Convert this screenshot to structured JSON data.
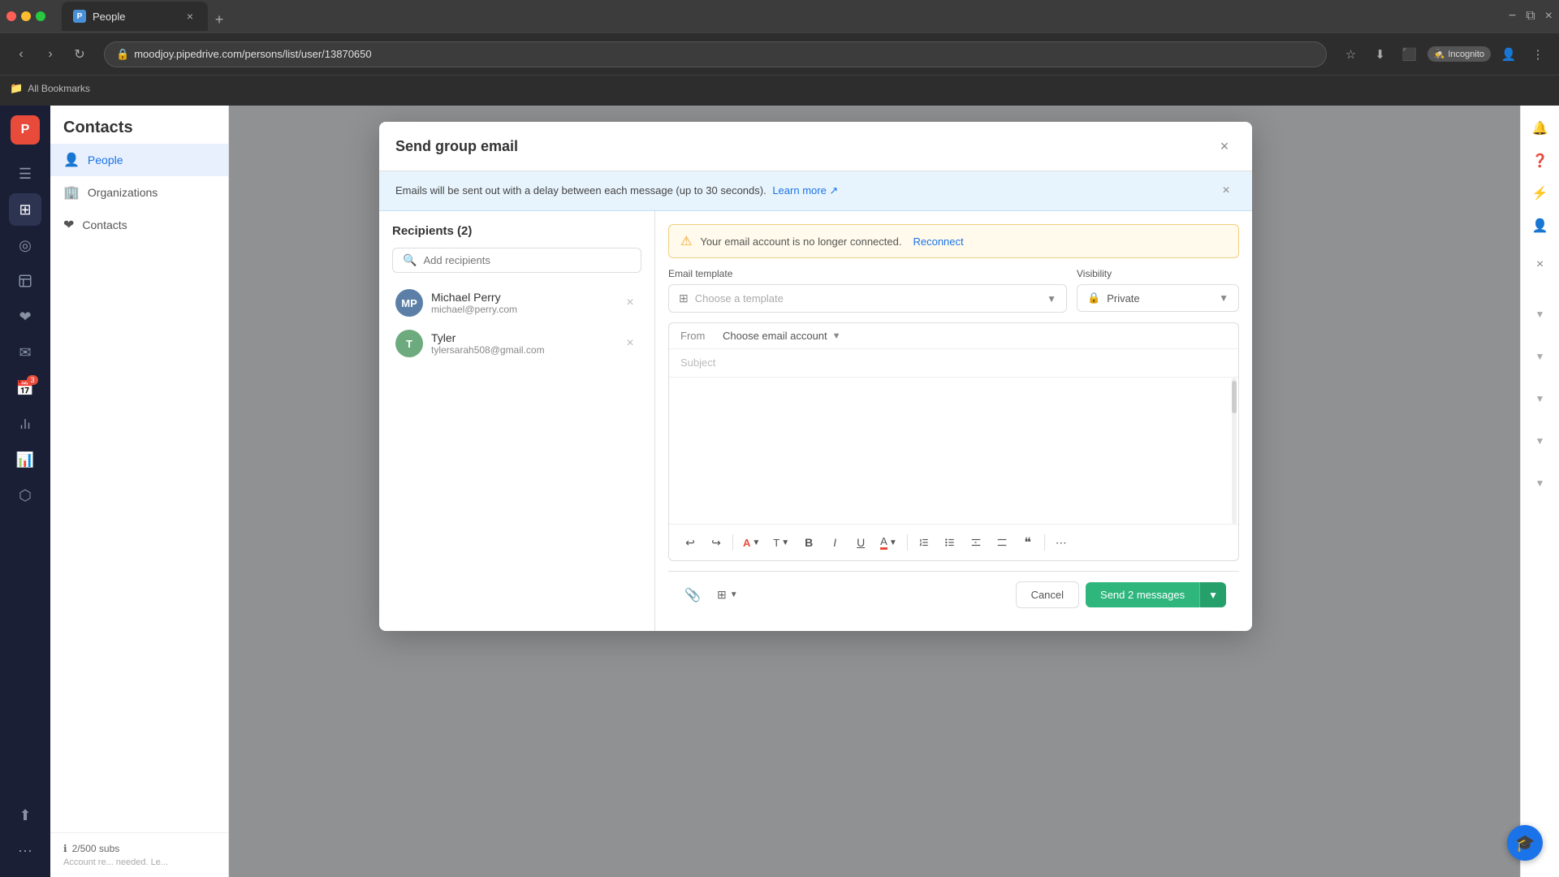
{
  "browser": {
    "tab_title": "People",
    "tab_favicon": "P",
    "address": "moodjoy.pipedrive.com/persons/list/user/13870650",
    "incognito_label": "Incognito",
    "bookmarks_label": "All Bookmarks"
  },
  "sidebar": {
    "logo": "P",
    "nav_items": [
      {
        "icon": "⊞",
        "label": "dashboard"
      },
      {
        "icon": "◎",
        "label": "activities"
      },
      {
        "icon": "📋",
        "label": "deals"
      },
      {
        "icon": "❤",
        "label": "leads"
      },
      {
        "icon": "✉",
        "label": "mail"
      },
      {
        "icon": "📅",
        "label": "calendar",
        "badge": "3"
      },
      {
        "icon": "☰",
        "label": "reports"
      },
      {
        "icon": "📊",
        "label": "analytics"
      },
      {
        "icon": "⬡",
        "label": "integrations"
      }
    ],
    "bottom_items": [
      {
        "icon": "↑↓",
        "label": "import"
      },
      {
        "icon": "⋯",
        "label": "more"
      }
    ]
  },
  "secondary_sidebar": {
    "header": "Contacts",
    "nav_items": [
      {
        "label": "People",
        "icon": "👤",
        "active": true
      },
      {
        "label": "Organizations",
        "icon": "🏢"
      },
      {
        "label": "Contacts",
        "icon": "❤"
      }
    ],
    "subscription": {
      "text": "2/500 subs",
      "subtext": "Account re... needed. Le..."
    }
  },
  "dialog": {
    "title": "Send group email",
    "close_label": "×",
    "info_banner": {
      "text": "Emails will be sent out with a delay between each message (up to 30 seconds).",
      "link_text": "Learn more ↗",
      "close_label": "×"
    },
    "recipients": {
      "section_title": "Recipients (2)",
      "search_placeholder": "Add recipients",
      "items": [
        {
          "initials": "MP",
          "name": "Michael Perry",
          "email": "michael@perry.com",
          "avatar_class": "avatar-mp"
        },
        {
          "initials": "T",
          "name": "Tyler",
          "email": "tylersarah508@gmail.com",
          "avatar_class": "avatar-t"
        }
      ]
    },
    "compose": {
      "warning": {
        "text": "Your email account is no longer connected.",
        "link_text": "Reconnect"
      },
      "email_template_label": "Email template",
      "template_placeholder": "Choose a template",
      "visibility_label": "Visibility",
      "visibility_value": "Private",
      "from_label": "From",
      "from_placeholder": "Choose email account",
      "subject_placeholder": "Subject"
    },
    "toolbar": {
      "buttons": [
        "↩",
        "↪",
        "A",
        "T",
        "B",
        "I",
        "U",
        "A",
        "≡",
        "≣",
        "⬛",
        "⬚",
        "❝",
        "⋯"
      ]
    },
    "footer": {
      "cancel_label": "Cancel",
      "send_label": "Send 2 messages"
    }
  },
  "right_panel": {
    "buttons": [
      "🔔",
      "❓",
      "⚡",
      "👤"
    ]
  },
  "help_btn": "🎓"
}
